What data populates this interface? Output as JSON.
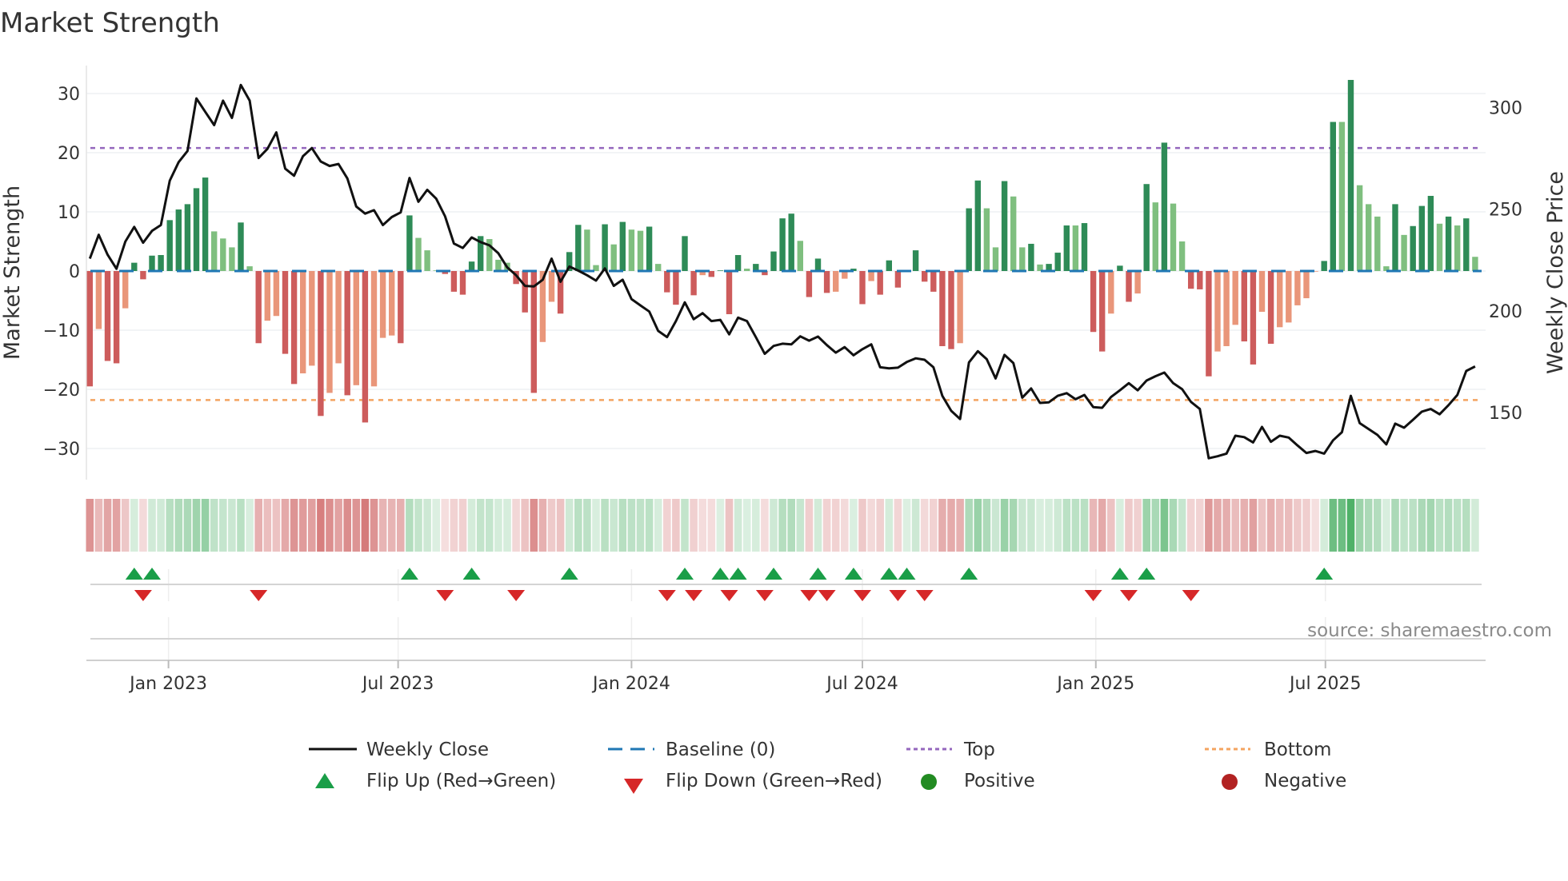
{
  "title": "Market Strength",
  "source": "source: sharemaestro.com",
  "legend": {
    "weekly_close": "Weekly Close",
    "baseline": "Baseline (0)",
    "top": "Top",
    "bottom": "Bottom",
    "flip_up": "Flip Up (Red→Green)",
    "flip_down": "Flip Down (Green→Red)",
    "positive": "Positive",
    "negative": "Negative"
  },
  "colors": {
    "pos_dark": "#2e8b57",
    "pos_light": "#7fbf7f",
    "neg_dark": "#cd5c5c",
    "neg_light": "#e9967a",
    "baseline": "#1f77b4",
    "top": "#9467bd",
    "bottom": "#f4a460",
    "flip_up": "#1a9e48",
    "flip_down": "#d62728",
    "positive_dot": "#228b22",
    "negative_dot": "#b22222",
    "price_line": "#111111"
  },
  "chart_data": {
    "type": "bar",
    "title": "Market Strength",
    "ylabel": "Market Strength",
    "y2label": "Weekly Close Price",
    "xlabel": "",
    "frequency": "weekly",
    "start_date": "2022-10-31",
    "ylim": [
      -36,
      35
    ],
    "y2lim": [
      123,
      318
    ],
    "yticks": [
      30,
      20,
      10,
      0,
      -10,
      -20,
      -30
    ],
    "ytick_labels": [
      "30",
      "20",
      "10",
      "0",
      "−10",
      "−20",
      "−30"
    ],
    "y2ticks": [
      300,
      250,
      200,
      150
    ],
    "y2tick_labels": [
      "300",
      "250",
      "200",
      "150"
    ],
    "xticks": [
      {
        "date": "2023-01-01",
        "label": "Jan 2023"
      },
      {
        "date": "2023-07-01",
        "label": "Jul 2023"
      },
      {
        "date": "2024-01-01",
        "label": "Jan 2024"
      },
      {
        "date": "2024-07-01",
        "label": "Jul 2024"
      },
      {
        "date": "2025-01-01",
        "label": "Jan 2025"
      },
      {
        "date": "2025-07-01",
        "label": "Jul 2025"
      }
    ],
    "top_level": 20.8,
    "bottom_level": -21.8,
    "baseline_level": 0,
    "grid": true,
    "legend_position": "bottom",
    "strength": [
      -19.5,
      -9.8,
      -15.2,
      -15.6,
      -6.3,
      1.4,
      -1.4,
      2.6,
      2.7,
      8.6,
      10.4,
      11.3,
      14.0,
      15.8,
      6.7,
      5.5,
      4.0,
      8.2,
      0.8,
      -12.2,
      -8.4,
      -7.6,
      -14.0,
      -19.1,
      -17.3,
      -16.0,
      -24.5,
      -20.6,
      -15.6,
      -21.0,
      -19.3,
      -25.6,
      -19.5,
      -11.3,
      -10.9,
      -12.2,
      9.4,
      5.6,
      3.5,
      0.1,
      -0.5,
      -3.5,
      -4.0,
      1.6,
      5.9,
      5.4,
      1.9,
      1.4,
      -2.2,
      -7.0,
      -20.6,
      -12.0,
      -5.2,
      -7.2,
      3.2,
      7.8,
      7.0,
      1.0,
      7.9,
      4.5,
      8.3,
      7.0,
      6.8,
      7.5,
      1.2,
      -3.6,
      -5.7,
      5.9,
      -4.1,
      -0.7,
      -1.0,
      0.1,
      -7.3,
      2.7,
      0.4,
      1.2,
      -0.7,
      3.3,
      8.9,
      9.7,
      5.1,
      -4.4,
      2.1,
      -3.7,
      -3.5,
      -1.3,
      0.4,
      -5.6,
      -1.7,
      -4.0,
      1.8,
      -2.8,
      0.1,
      3.5,
      -1.8,
      -3.5,
      -12.7,
      -13.2,
      -12.2,
      10.6,
      15.3,
      10.6,
      4.0,
      15.2,
      12.6,
      4.0,
      4.6,
      1.1,
      1.2,
      3.1,
      7.7,
      7.7,
      8.1,
      -10.3,
      -13.6,
      -7.2,
      0.9,
      -5.2,
      -3.8,
      14.7,
      11.6,
      21.7,
      11.4,
      5.0,
      -3.0,
      -3.1,
      -17.8,
      -13.6,
      -12.7,
      -9.1,
      -11.9,
      -15.8,
      -6.9,
      -12.3,
      -9.5,
      -8.7,
      -5.8,
      -4.6,
      -0.1,
      1.7,
      25.2,
      25.2,
      32.3,
      14.5,
      11.3,
      9.2,
      0.8,
      11.3,
      6.1,
      7.6,
      11.0,
      12.7,
      8.0,
      9.2,
      7.7,
      8.9,
      2.4
    ],
    "weekly_close": [
      225.7,
      237.4,
      227.6,
      220.7,
      234.1,
      241.3,
      233.5,
      239.3,
      242.2,
      264,
      273.1,
      278.6,
      304.4,
      297.8,
      291.3,
      303.3,
      294.8,
      311,
      303.3,
      275.1,
      279.6,
      287.7,
      269.9,
      266.4,
      276,
      280,
      273.4,
      271.2,
      272.2,
      265.1,
      251.3,
      247.8,
      249.5,
      242.2,
      246.1,
      248.4,
      265.3,
      253.6,
      259.5,
      255.2,
      246.5,
      233.1,
      230.9,
      236.1,
      233.8,
      232.2,
      228.3,
      221.4,
      217.5,
      212.3,
      212,
      215.3,
      225.7,
      214.3,
      221.8,
      219.8,
      217.5,
      214.9,
      220.9,
      212.3,
      215.3,
      205.8,
      202.7,
      199.7,
      190.2,
      187.1,
      195,
      204.2,
      195.9,
      198.9,
      195,
      195.6,
      188.5,
      196.7,
      195,
      187.1,
      178.9,
      182.8,
      183.9,
      183.6,
      187.5,
      185.4,
      187.4,
      183.2,
      179.5,
      182.2,
      178.2,
      181.2,
      183.6,
      172.3,
      171.8,
      172.1,
      174.9,
      176.7,
      176,
      172.3,
      158.3,
      150.9,
      146.9,
      174.7,
      180.2,
      176.3,
      166.8,
      178.4,
      174.4,
      157.4,
      161.9,
      154.8,
      155.1,
      158.3,
      159.6,
      156.6,
      158.7,
      152.7,
      152.4,
      157.7,
      161,
      164.5,
      161,
      165.8,
      167.9,
      169.7,
      164.5,
      161.6,
      155.3,
      151.8,
      127.6,
      128.6,
      129.9,
      138.7,
      138,
      135.4,
      143,
      135.7,
      138.7,
      137.8,
      133.9,
      130.2,
      131.2,
      129.9,
      136.4,
      140.4,
      158.3,
      144.9,
      142,
      139.1,
      134.4,
      144.6,
      142.6,
      146.5,
      150.5,
      151.8,
      149.2,
      153.7,
      158.7,
      170.5,
      172.7
    ]
  }
}
